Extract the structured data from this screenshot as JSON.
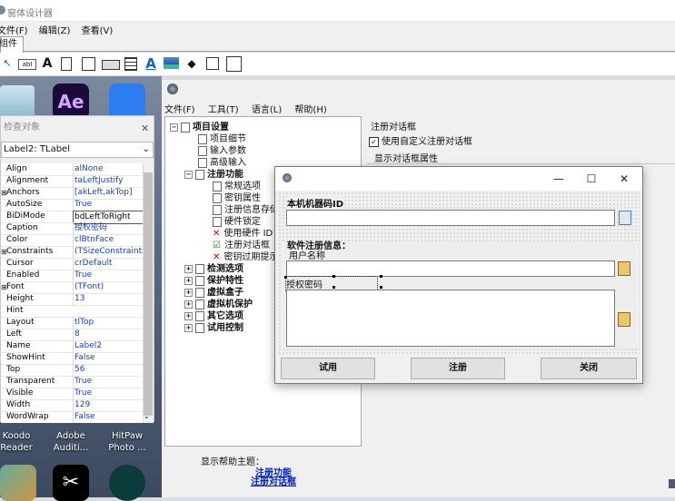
{
  "designer": {
    "title": "窗体设计器",
    "menu": [
      "文件(F)",
      "编辑(Z)",
      "查看(V)"
    ],
    "tab": "组件"
  },
  "desktop": {
    "labels": [
      {
        "line1": "Koodo",
        "line2": "Reader"
      },
      {
        "line1": "Adobe",
        "line2": "Auditi..."
      },
      {
        "line1": "HitPaw",
        "line2": "Photo ..."
      }
    ]
  },
  "inspector": {
    "title": "检查对象",
    "selected": "Label2: TLabel",
    "properties": [
      {
        "name": "Align",
        "value": "alNone",
        "exp": ""
      },
      {
        "name": "Alignment",
        "value": "taLeftJustify",
        "exp": ""
      },
      {
        "name": "Anchors",
        "value": "[akLeft,akTop]",
        "exp": "⊞"
      },
      {
        "name": "AutoSize",
        "value": "True",
        "exp": ""
      },
      {
        "name": "BiDiMode",
        "value": "bdLeftToRight",
        "exp": ""
      },
      {
        "name": "Caption",
        "value": "授权密码",
        "exp": ""
      },
      {
        "name": "Color",
        "value": "clBtnFace",
        "exp": ""
      },
      {
        "name": "Constraints",
        "value": "(TSizeConstraints)",
        "exp": "⊞"
      },
      {
        "name": "Cursor",
        "value": "crDefault",
        "exp": ""
      },
      {
        "name": "Enabled",
        "value": "True",
        "exp": ""
      },
      {
        "name": "Font",
        "value": "(TFont)",
        "exp": "⊞"
      },
      {
        "name": "Height",
        "value": "13",
        "exp": ""
      },
      {
        "name": "Hint",
        "value": "",
        "exp": ""
      },
      {
        "name": "Layout",
        "value": "tlTop",
        "exp": ""
      },
      {
        "name": "Left",
        "value": "8",
        "exp": ""
      },
      {
        "name": "Name",
        "value": "Label2",
        "exp": ""
      },
      {
        "name": "ShowHint",
        "value": "False",
        "exp": ""
      },
      {
        "name": "Top",
        "value": "56",
        "exp": ""
      },
      {
        "name": "Transparent",
        "value": "True",
        "exp": ""
      },
      {
        "name": "Visible",
        "value": "True",
        "exp": ""
      },
      {
        "name": "Width",
        "value": "129",
        "exp": ""
      },
      {
        "name": "WordWrap",
        "value": "False",
        "exp": ""
      }
    ]
  },
  "app": {
    "menu": [
      "文件(F)",
      "工具(T)",
      "语言(L)",
      "帮助(H)"
    ],
    "tree": {
      "root": "项目设置",
      "root_children": [
        "项目细节",
        "输入参数",
        "高级输入"
      ],
      "reg": "注册功能",
      "reg_children": [
        "常规选项",
        "密钥属性",
        "注册信息存储",
        "硬件锁定",
        "使用硬件 ID",
        "注册对话框",
        "密钥过期提示"
      ],
      "others": [
        "检测选项",
        "保护特性",
        "虚拟盒子",
        "虚拟机保护",
        "其它选项",
        "试用控制"
      ]
    },
    "right": {
      "section": "注册对话框",
      "checkbox": "使用自定义注册对话框",
      "sub": "显示对话框属性"
    },
    "help": {
      "label": "显示帮助主题：",
      "links": [
        "注册功能",
        "注册对话框"
      ]
    }
  },
  "dialog": {
    "machine_id_label": "本机机器码ID",
    "reg_info_label": "软件注册信息：",
    "username_label": "用户名称",
    "password_label": "授权密码",
    "buttons": [
      "试用",
      "注册",
      "关闭"
    ]
  }
}
